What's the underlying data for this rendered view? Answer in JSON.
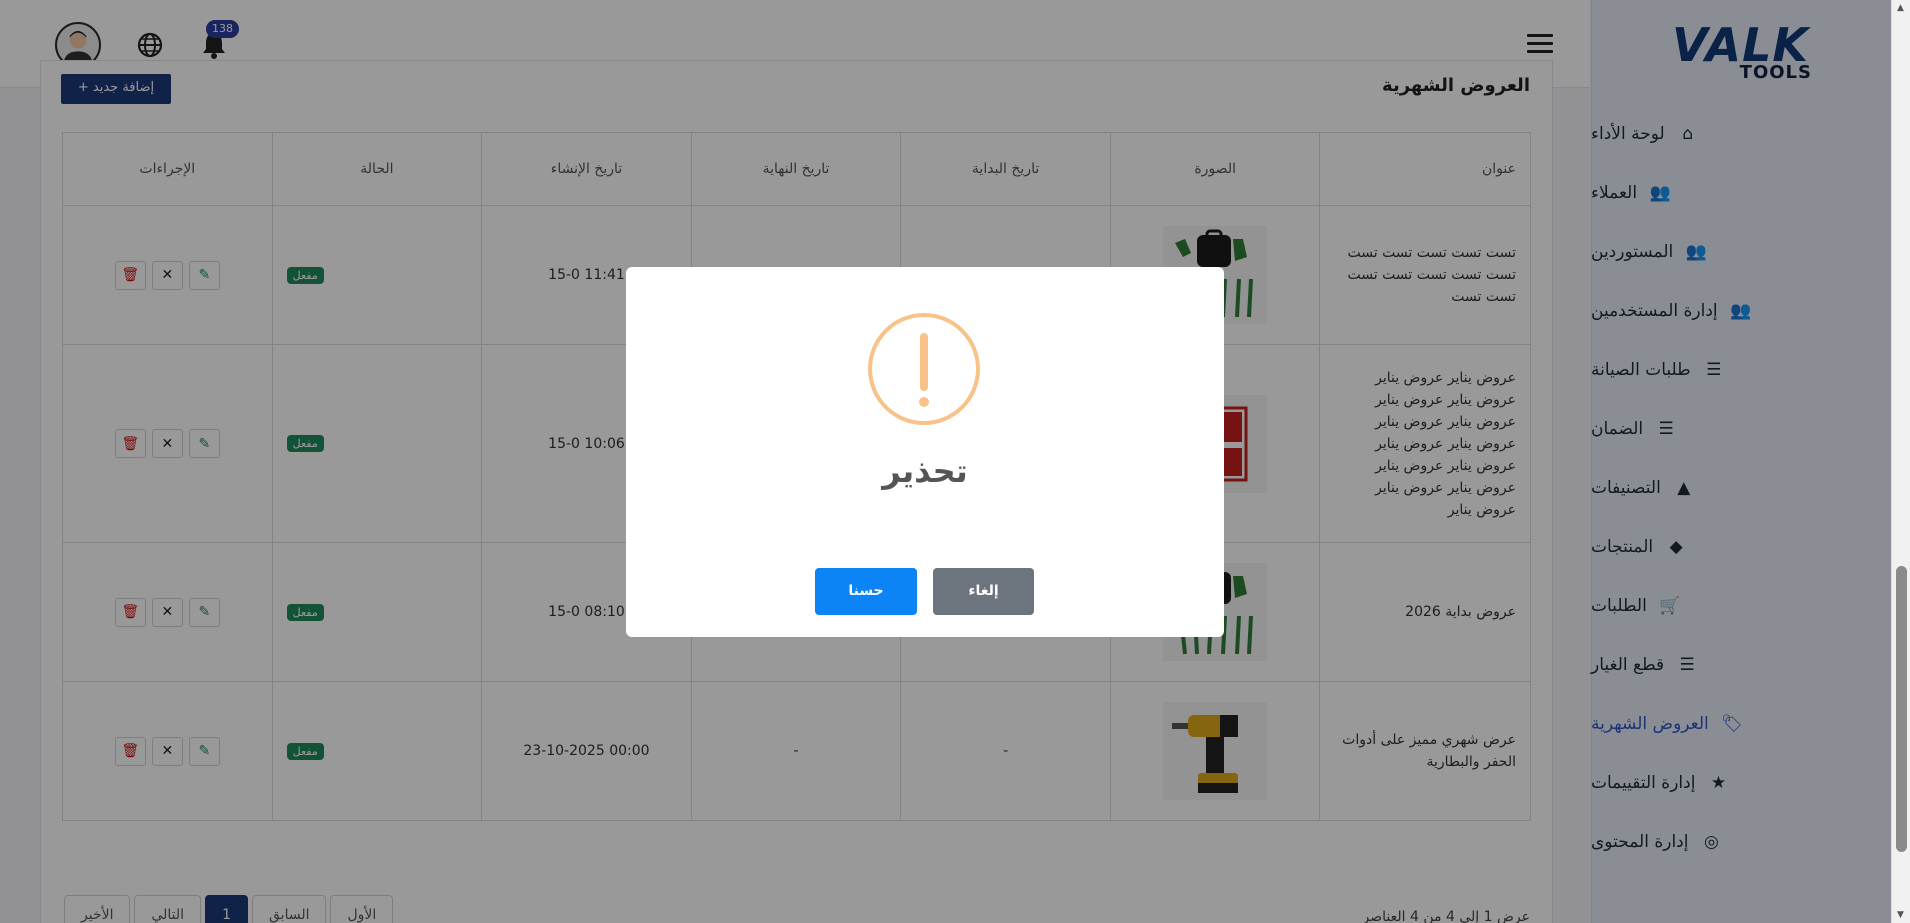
{
  "header": {
    "notification_count": "138",
    "icons": [
      "avatar",
      "globe-icon",
      "bell-icon",
      "hamburger-icon"
    ]
  },
  "sidebar": {
    "logo_main": "VALK",
    "logo_sub": "TOOLS",
    "items": [
      {
        "label": "لوحة الأداء",
        "icon": "home-icon"
      },
      {
        "label": "العملاء",
        "icon": "users-icon"
      },
      {
        "label": "المستوردين",
        "icon": "users-icon"
      },
      {
        "label": "إدارة المستخدمين",
        "icon": "users-icon"
      },
      {
        "label": "طلبات الصيانة",
        "icon": "list-icon"
      },
      {
        "label": "الضمان",
        "icon": "list-icon"
      },
      {
        "label": "التصنيفات",
        "icon": "shapes-icon"
      },
      {
        "label": "المنتجات",
        "icon": "box-icon"
      },
      {
        "label": "الطلبات",
        "icon": "cart-icon"
      },
      {
        "label": "قطع الغيار",
        "icon": "list-icon"
      },
      {
        "label": "العروض الشهرية",
        "icon": "tags-icon",
        "active": true
      },
      {
        "label": "إدارة التقييمات",
        "icon": "star-icon"
      },
      {
        "label": "إدارة المحتوى",
        "icon": "globe-icon"
      }
    ]
  },
  "main": {
    "title": "العروض الشهرية",
    "add_button": "+ إضافة جديد",
    "table": {
      "headers": [
        "عنوان",
        "الصورة",
        "تاريخ البداية",
        "تاريخ النهاية",
        "تاريخ الإنشاء",
        "الحالة",
        "الإجراءات"
      ],
      "rows": [
        {
          "title": "تست تست تست تست تست تست تست تست تست تست تست تست",
          "image": "garden-tools",
          "start": "",
          "end": "",
          "created": "11:41 15-0",
          "status": "مفعل"
        },
        {
          "title": "عروض يناير عروض يناير عروض يناير عروض يناير عروض يناير عروض يناير عروض يناير عروض يناير عروض يناير عروض يناير عروض يناير عروض يناير عروض يناير",
          "image": "special-offers",
          "start": "",
          "end": "",
          "created": "10:06 15-0",
          "status": "مفعل"
        },
        {
          "title": "عروض بداية 2026",
          "image": "garden-tools",
          "start": "",
          "end": "",
          "created": "08:10 15-0",
          "status": "مفعل"
        },
        {
          "title": "عرض شهري مميز على أدوات الحفر والبطارية",
          "image": "drill",
          "start": "-",
          "end": "-",
          "created": "00:00 23-10-2025",
          "status": "مفعل"
        }
      ]
    },
    "pagination": {
      "first": "الأول",
      "prev": "السابق",
      "current": "1",
      "next": "التالي",
      "last": "الأخير",
      "info": "عرض 1 إلى 4 من 4 العناصر"
    }
  },
  "modal": {
    "title": "تحذير",
    "ok_label": "حسنا",
    "cancel_label": "إلغاء",
    "accent": "#f8c289",
    "ok_color": "#0d84f6",
    "cancel_color": "#6c757d"
  }
}
